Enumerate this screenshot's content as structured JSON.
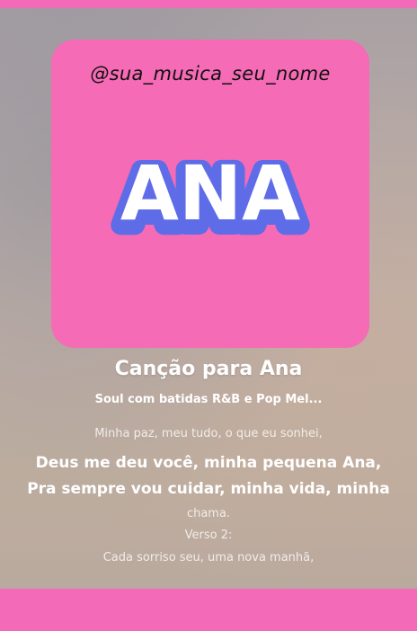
{
  "cover": {
    "handle": "@sua_musica_seu_nome",
    "name": "ANA",
    "bg_color": "#f56bb5",
    "name_fill": "#ffffff",
    "name_outline": "#5f6ce8"
  },
  "song": {
    "title": "Canção para Ana",
    "style": "Soul com batidas R&B e Pop Mel..."
  },
  "lyrics": [
    "Minha paz, meu tudo, o que eu sonhei,",
    "Deus me deu você, minha pequena Ana,",
    "Pra sempre vou cuidar, minha vida, minha",
    "chama.",
    "Verso 2:",
    "Cada sorriso seu, uma nova manhã,"
  ],
  "accent_color": "#f36bb8"
}
